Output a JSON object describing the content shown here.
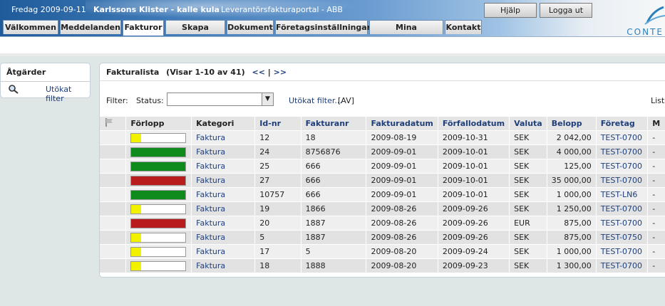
{
  "header": {
    "date": "Fredag 2009-09-11",
    "user": "Karlssons Klister - kalle kula",
    "portal": "Leverantörsfakturaportal - ABB",
    "help_label": "Hjälp",
    "logout_label": "Logga ut",
    "logo_text": "CONTE"
  },
  "tabs": [
    "Välkommen",
    "Meddelanden",
    "Fakturor",
    "Skapa faktura",
    "Dokument",
    "Företagsinställningar",
    "Mina inställningar",
    "Kontakt"
  ],
  "active_tab": "Fakturor",
  "actions": {
    "title": "Åtgärder",
    "extended_filter": "Utökat filter",
    "search_icon": "magnifier-icon"
  },
  "list": {
    "title": "Fakturalista",
    "showing": "(Visar 1-10 av 41)",
    "prev": "<<",
    "sep": "|",
    "next": ">>",
    "filter_label": "Filter:",
    "status_label": "Status:",
    "status_value": "",
    "extended_filter": "Utökat filter...",
    "av": "[AV]",
    "lists_label": "Lists",
    "flag_icon": "flag-icon"
  },
  "columns": [
    "Förlopp",
    "Kategori",
    "Id-nr",
    "Fakturanr",
    "Fakturadatum",
    "Förfallodatum",
    "Valuta",
    "Belopp",
    "Företag",
    "M"
  ],
  "colors": {
    "yellow": "#f2f200",
    "green": "#0f8a1c",
    "red": "#b81c1c"
  },
  "rows": [
    {
      "status": "yellow",
      "progress": 0.18,
      "kategori": "Faktura",
      "id": "12",
      "fakturanr": "18",
      "fakturadatum": "2009-08-19",
      "forfallodatum": "2009-10-31",
      "valuta": "SEK",
      "belopp": "2 042,00",
      "foretag": "TEST-0700",
      "m": "-"
    },
    {
      "status": "green",
      "progress": 1,
      "kategori": "Faktura",
      "id": "24",
      "fakturanr": "8756876",
      "fakturadatum": "2009-09-01",
      "forfallodatum": "2009-10-01",
      "valuta": "SEK",
      "belopp": "4 000,00",
      "foretag": "TEST-0700",
      "m": "-"
    },
    {
      "status": "green",
      "progress": 1,
      "kategori": "Faktura",
      "id": "25",
      "fakturanr": "666",
      "fakturadatum": "2009-09-01",
      "forfallodatum": "2009-10-01",
      "valuta": "SEK",
      "belopp": "125,00",
      "foretag": "TEST-0700",
      "m": "-"
    },
    {
      "status": "red",
      "progress": 1,
      "kategori": "Faktura",
      "id": "27",
      "fakturanr": "666",
      "fakturadatum": "2009-09-01",
      "forfallodatum": "2009-10-01",
      "valuta": "SEK",
      "belopp": "35 000,00",
      "foretag": "TEST-0700",
      "m": "-"
    },
    {
      "status": "green",
      "progress": 1,
      "kategori": "Faktura",
      "id": "10757",
      "fakturanr": "666",
      "fakturadatum": "2009-09-01",
      "forfallodatum": "2009-10-01",
      "valuta": "SEK",
      "belopp": "1 000,00",
      "foretag": "TEST-LN6",
      "m": "-"
    },
    {
      "status": "yellow",
      "progress": 0.18,
      "kategori": "Faktura",
      "id": "19",
      "fakturanr": "1866",
      "fakturadatum": "2009-08-26",
      "forfallodatum": "2009-09-26",
      "valuta": "SEK",
      "belopp": "1 250,00",
      "foretag": "TEST-0700",
      "m": "-"
    },
    {
      "status": "red",
      "progress": 1,
      "kategori": "Faktura",
      "id": "20",
      "fakturanr": "1887",
      "fakturadatum": "2009-08-26",
      "forfallodatum": "2009-09-26",
      "valuta": "EUR",
      "belopp": "875,00",
      "foretag": "TEST-0700",
      "m": "-"
    },
    {
      "status": "yellow",
      "progress": 0.18,
      "kategori": "Faktura",
      "id": "5",
      "fakturanr": "1887",
      "fakturadatum": "2009-08-26",
      "forfallodatum": "2009-09-26",
      "valuta": "SEK",
      "belopp": "875,00",
      "foretag": "TEST-0750",
      "m": "-"
    },
    {
      "status": "yellow",
      "progress": 0.18,
      "kategori": "Faktura",
      "id": "17",
      "fakturanr": "5",
      "fakturadatum": "2009-08-20",
      "forfallodatum": "2009-09-24",
      "valuta": "SEK",
      "belopp": "1 000,00",
      "foretag": "TEST-0700",
      "m": "-"
    },
    {
      "status": "yellow",
      "progress": 0.18,
      "kategori": "Faktura",
      "id": "18",
      "fakturanr": "1888",
      "fakturadatum": "2009-08-20",
      "forfallodatum": "2009-09-23",
      "valuta": "SEK",
      "belopp": "1 300,00",
      "foretag": "TEST-0700",
      "m": "-"
    }
  ]
}
